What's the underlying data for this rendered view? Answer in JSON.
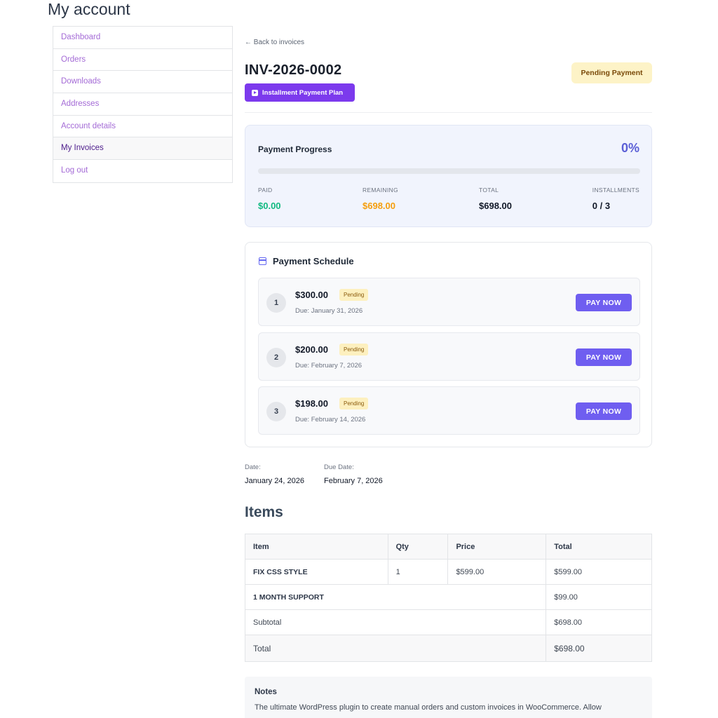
{
  "page": {
    "title": "My account"
  },
  "sidebar": {
    "items": [
      {
        "label": "Dashboard"
      },
      {
        "label": "Orders"
      },
      {
        "label": "Downloads"
      },
      {
        "label": "Addresses"
      },
      {
        "label": "Account details"
      },
      {
        "label": "My Invoices",
        "active": true
      },
      {
        "label": "Log out"
      }
    ]
  },
  "invoice": {
    "back_label": "← Back to invoices",
    "number": "INV-2026-0002",
    "plan_label": "Installment Payment Plan",
    "status": "Pending Payment"
  },
  "progress": {
    "title": "Payment Progress",
    "percent_label": "0%",
    "percent": 0,
    "paid_label": "PAID",
    "paid_value": "$0.00",
    "remaining_label": "REMAINING",
    "remaining_value": "$698.00",
    "total_label": "TOTAL",
    "total_value": "$698.00",
    "installments_label": "INSTALLMENTS",
    "installments_value": "0 / 3"
  },
  "schedule": {
    "title": "Payment Schedule",
    "installments": [
      {
        "number": "1",
        "amount": "$300.00",
        "status": "Pending",
        "due": "Due: January 31, 2026",
        "button": "PAY NOW"
      },
      {
        "number": "2",
        "amount": "$200.00",
        "status": "Pending",
        "due": "Due: February 7, 2026",
        "button": "PAY NOW"
      },
      {
        "number": "3",
        "amount": "$198.00",
        "status": "Pending",
        "due": "Due: February 14, 2026",
        "button": "PAY NOW"
      }
    ]
  },
  "dates": {
    "date_label": "Date:",
    "date_value": "January 24, 2026",
    "due_label": "Due Date:",
    "due_value": "February 7, 2026"
  },
  "items": {
    "heading": "Items",
    "headers": {
      "item": "Item",
      "qty": "Qty",
      "price": "Price",
      "total": "Total"
    },
    "rows": [
      {
        "item": "FIX CSS STYLE",
        "qty": "1",
        "price": "$599.00",
        "total": "$599.00"
      },
      {
        "item": "1 MONTH SUPPORT",
        "total": "$99.00"
      }
    ],
    "subtotal_label": "Subtotal",
    "subtotal_value": "$698.00",
    "total_label": "Total",
    "total_value": "$698.00"
  },
  "notes": {
    "title": "Notes",
    "body": "The ultimate WordPress plugin to create manual orders and custom invoices in WooCommerce. Allow"
  },
  "colors": {
    "accent": "#7c3aed",
    "button": "#6f5ef0",
    "paid": "#10b981",
    "remaining": "#f59e0b",
    "progress_pct": "#5b5fd6"
  }
}
